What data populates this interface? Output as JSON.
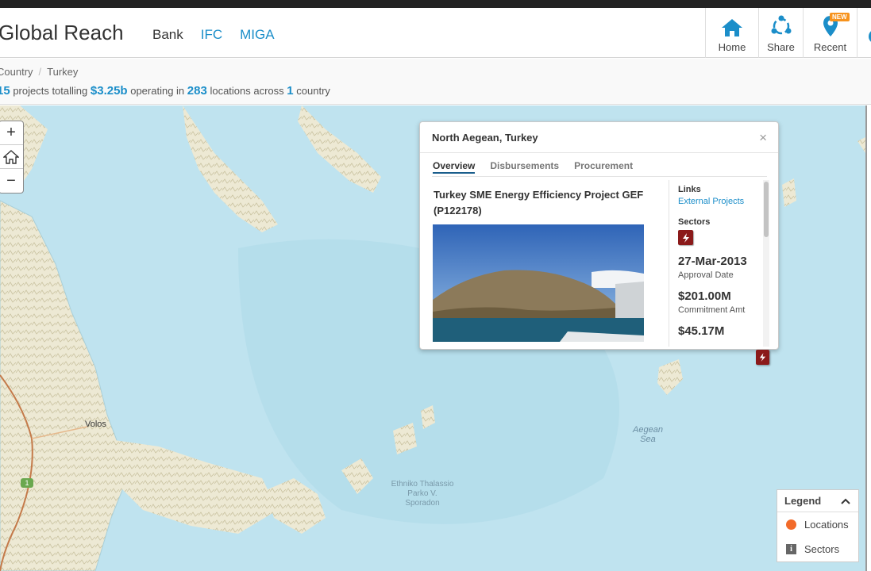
{
  "header": {
    "brand": "Global Reach",
    "nav": {
      "bank": "Bank",
      "ifc": "IFC",
      "miga": "MIGA"
    },
    "buttons": {
      "home": "Home",
      "share": "Share",
      "recent": "Recent",
      "new_badge": "NEW"
    }
  },
  "breadcrumb": {
    "root": "Country",
    "separator": "/",
    "current": "Turkey"
  },
  "summary": {
    "projects_count": "15",
    "projects_text": "projects totalling",
    "amount": "$3.25b",
    "operating_text": "operating in",
    "locations_count": "283",
    "locations_text": "locations across",
    "country_count": "1",
    "country_text": "country"
  },
  "zoom": {
    "in": "+",
    "out": "−"
  },
  "popup": {
    "title": "North Aegean, Turkey",
    "close": "×",
    "tabs": [
      "Overview",
      "Disbursements",
      "Procurement"
    ],
    "project_name": "Turkey SME Energy Efficiency Project GEF (P122178)",
    "links_label": "Links",
    "links_value": "External Projects",
    "sectors_label": "Sectors",
    "approval_value": "27-Mar-2013",
    "approval_label": "Approval Date",
    "commitment_value": "$201.00M",
    "commitment_label": "Commitment Amt",
    "next_value_partial": "$45.17M"
  },
  "map": {
    "city_label": "Volos",
    "road_label": "1",
    "sea_label_line1": "Aegean",
    "sea_label_line2": "Sea",
    "park_label_line1": "Ethniko Thalassio",
    "park_label_line2": "Parko V.",
    "park_label_line3": "Sporadon"
  },
  "legend": {
    "title": "Legend",
    "items": [
      {
        "label": "Locations",
        "color": "#f26b2a"
      },
      {
        "label": "Sectors",
        "icon": "info-icon"
      }
    ]
  },
  "colors": {
    "accent": "#1b8ec9",
    "sector": "#8b1a1a",
    "location": "#f26b2a"
  }
}
